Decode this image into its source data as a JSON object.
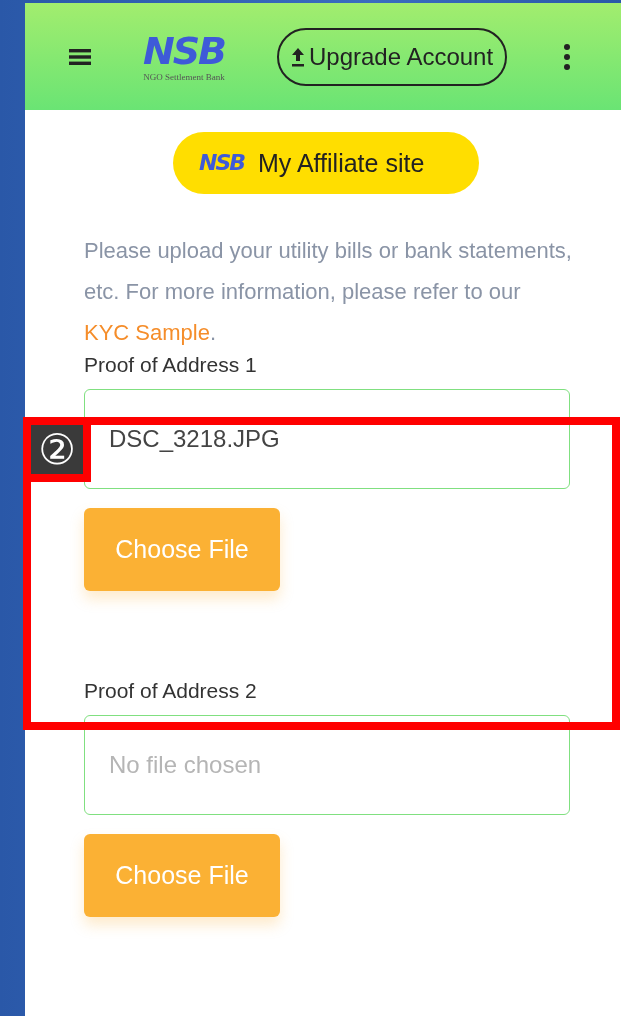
{
  "header": {
    "logo": {
      "mark": "NSB",
      "tagline": "NGO Settlement Bank"
    },
    "upgrade_button": "Upgrade Account"
  },
  "affiliate_button": {
    "mark": "NSB",
    "label": "My Affiliate site"
  },
  "instructions": {
    "text": "Please upload your utility bills or bank statements, etc. For more information, please refer to our ",
    "link": "KYC Sample",
    "end": "."
  },
  "uploads": [
    {
      "label": "Proof of Address 1",
      "value": "DSC_3218.JPG",
      "button": "Choose File"
    },
    {
      "label": "Proof of Address 2",
      "placeholder": "No file chosen",
      "button": "Choose File"
    }
  ],
  "annotation": {
    "number": "②"
  }
}
